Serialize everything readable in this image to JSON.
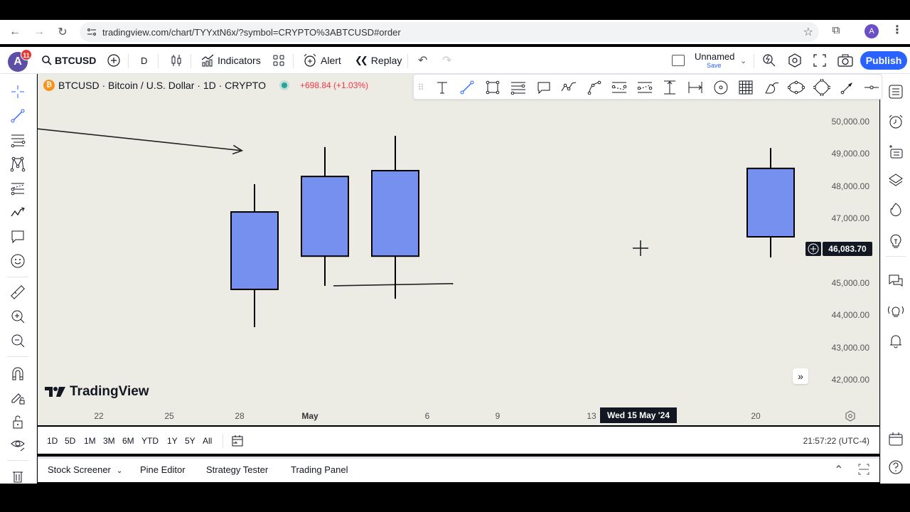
{
  "browser": {
    "url": "tradingview.com/chart/TYYxtN6x/?symbol=CRYPTO%3ABTCUSD#order",
    "profile_initial": "A"
  },
  "topbar": {
    "avatar_initial": "A",
    "notification_count": "11",
    "symbol": "BTCUSD",
    "interval": "D",
    "indicators_label": "Indicators",
    "alert_label": "Alert",
    "replay_label": "Replay",
    "layout_name": "Unnamed",
    "save_label": "Save",
    "publish_label": "Publish"
  },
  "chart_header": {
    "title": "BTCUSD · Bitcoin / U.S. Dollar · 1D · CRYPTO",
    "change": "+698.84 (+1.03%)",
    "change_color": "#f23645",
    "live_color": "#26a69a"
  },
  "logo_text": "TradingView",
  "crosshair": {
    "price_label": "46,083.70",
    "date_label": "Wed 15 May '24"
  },
  "chart_data": {
    "type": "candlestick",
    "title": "BTCUSD · Bitcoin / U.S. Dollar · 1D · CRYPTO",
    "ylim": [
      41500,
      51000
    ],
    "y_ticks": [
      "50,000.00",
      "49,000.00",
      "48,000.00",
      "47,000.00",
      "45,000.00",
      "44,000.00",
      "43,000.00",
      "42,000.00"
    ],
    "y_tick_values": [
      50000,
      49000,
      48000,
      47000,
      45000,
      44000,
      43000,
      42000
    ],
    "x_ticks": [
      {
        "label": "22",
        "day": -9,
        "bold": false
      },
      {
        "label": "25",
        "day": -6,
        "bold": false
      },
      {
        "label": "28",
        "day": -3,
        "bold": false
      },
      {
        "label": "May",
        "day": 0,
        "bold": true
      },
      {
        "label": "6",
        "day": 5,
        "bold": false
      },
      {
        "label": "9",
        "day": 8,
        "bold": false
      },
      {
        "label": "13",
        "day": 12,
        "bold": false
      },
      {
        "label": "20",
        "day": 19,
        "bold": false
      }
    ],
    "x_range_days": [
      -12.5,
      23.3
    ],
    "candles": [
      {
        "date": "2024-04-29",
        "day": -2,
        "open": 44800,
        "high": 48060,
        "low": 43630,
        "close": 47200
      },
      {
        "date": "2024-05-02",
        "day": 1,
        "open": 45830,
        "high": 49210,
        "low": 44910,
        "close": 48300
      },
      {
        "date": "2024-05-05",
        "day": 4,
        "open": 45830,
        "high": 49560,
        "low": 44510,
        "close": 48480
      },
      {
        "date": "2024-05-21",
        "day": 20,
        "open": 46430,
        "high": 49180,
        "low": 45790,
        "close": 48550
      }
    ],
    "drawings": [
      {
        "type": "arrow",
        "from": {
          "day": -13.2,
          "price": 49900
        },
        "to": {
          "day": -2.9,
          "price": 49100
        }
      },
      {
        "type": "trendline",
        "from": {
          "day": 1,
          "price": 44910
        },
        "to": {
          "day": 6.1,
          "price": 44980
        }
      }
    ],
    "body_color": "#7690f0",
    "wick_color": "#000000"
  },
  "range_buttons": [
    "1D",
    "5D",
    "1M",
    "3M",
    "6M",
    "YTD",
    "1Y",
    "5Y",
    "All"
  ],
  "clock": "21:57:22 (UTC-4)",
  "bottom_tabs": [
    "Stock Screener",
    "Pine Editor",
    "Strategy Tester",
    "Trading Panel"
  ]
}
